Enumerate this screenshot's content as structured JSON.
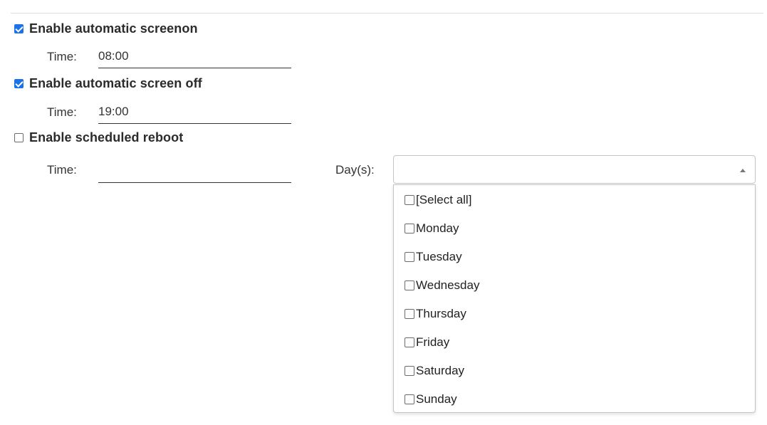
{
  "screen_on": {
    "label": "Enable automatic screenon",
    "checked": true,
    "time_label": "Time:",
    "time_value": "08:00"
  },
  "screen_off": {
    "label": "Enable automatic screen off",
    "checked": true,
    "time_label": "Time:",
    "time_value": "19:00"
  },
  "reboot": {
    "label": "Enable scheduled reboot",
    "checked": false,
    "time_label": "Time:",
    "time_value": "",
    "days_label": "Day(s):",
    "days_value": "",
    "days_options": [
      {
        "label": "[Select all]",
        "checked": false
      },
      {
        "label": "Monday",
        "checked": false
      },
      {
        "label": "Tuesday",
        "checked": false
      },
      {
        "label": "Wednesday",
        "checked": false
      },
      {
        "label": "Thursday",
        "checked": false
      },
      {
        "label": "Friday",
        "checked": false
      },
      {
        "label": "Saturday",
        "checked": false
      },
      {
        "label": "Sunday",
        "checked": false
      }
    ]
  },
  "colors": {
    "accent": "#1a73e8",
    "border": "#c4c4c4",
    "text": "#222222"
  }
}
